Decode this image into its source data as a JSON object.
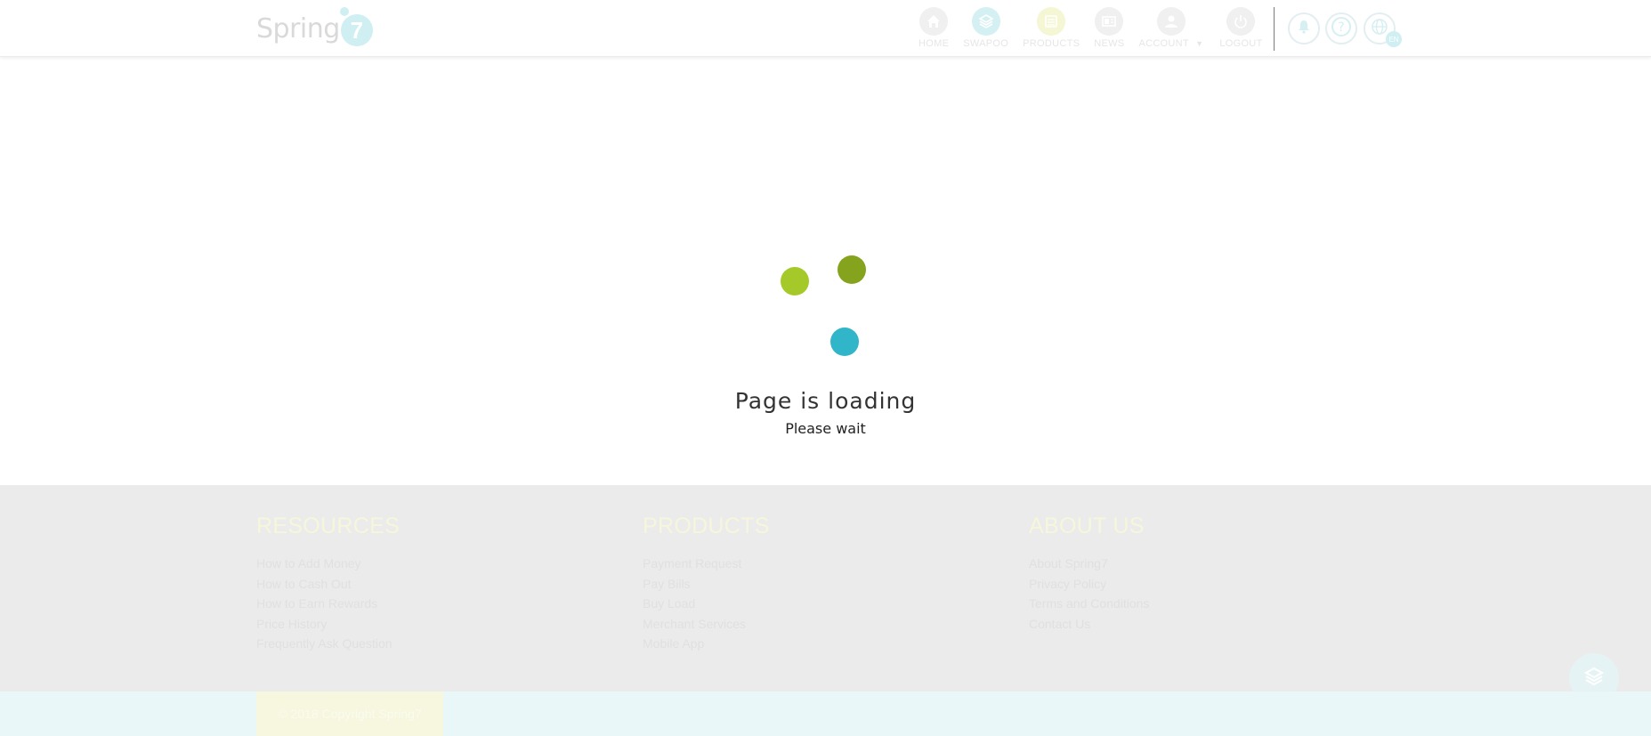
{
  "header": {
    "logo_text": "Spring",
    "logo_number": "7",
    "nav": [
      {
        "label": "HOME",
        "icon": "home-icon",
        "color": "#f0f0f0"
      },
      {
        "label": "SWAPOO",
        "icon": "swapoo-icon",
        "color": "#d4f0f3"
      },
      {
        "label": "PRODUCTS",
        "icon": "products-icon",
        "color": "#f4f6d4"
      },
      {
        "label": "NEWS",
        "icon": "news-icon",
        "color": "#f0f0f0"
      },
      {
        "label": "ACCOUNT",
        "icon": "account-icon",
        "color": "#f0f0f0"
      },
      {
        "label": "LOGOUT",
        "icon": "power-icon",
        "color": "#f0f0f0"
      }
    ],
    "language_badge": "EN"
  },
  "loader": {
    "title": "Page is loading",
    "subtitle": "Please wait",
    "dot_colors": [
      "#a6c92a",
      "#86a31d",
      "#30b5c9"
    ]
  },
  "footer": {
    "columns": [
      {
        "heading": "RESOURCES",
        "links": [
          "How to Add Money",
          "How to Cash Out",
          "How to Earn Rewards",
          "Price History",
          "Frequently Ask Question"
        ]
      },
      {
        "heading": "PRODUCTS",
        "links": [
          "Payment Request",
          "Pay Bills",
          "Buy Load",
          "Merchant Services",
          "Mobile App"
        ]
      },
      {
        "heading": "ABOUT US",
        "links": [
          "About Spring7",
          "Privacy Policy",
          "Terms and Conditions",
          "Contact Us"
        ]
      }
    ],
    "copyright": "© 2018 Copyright Spring7"
  }
}
